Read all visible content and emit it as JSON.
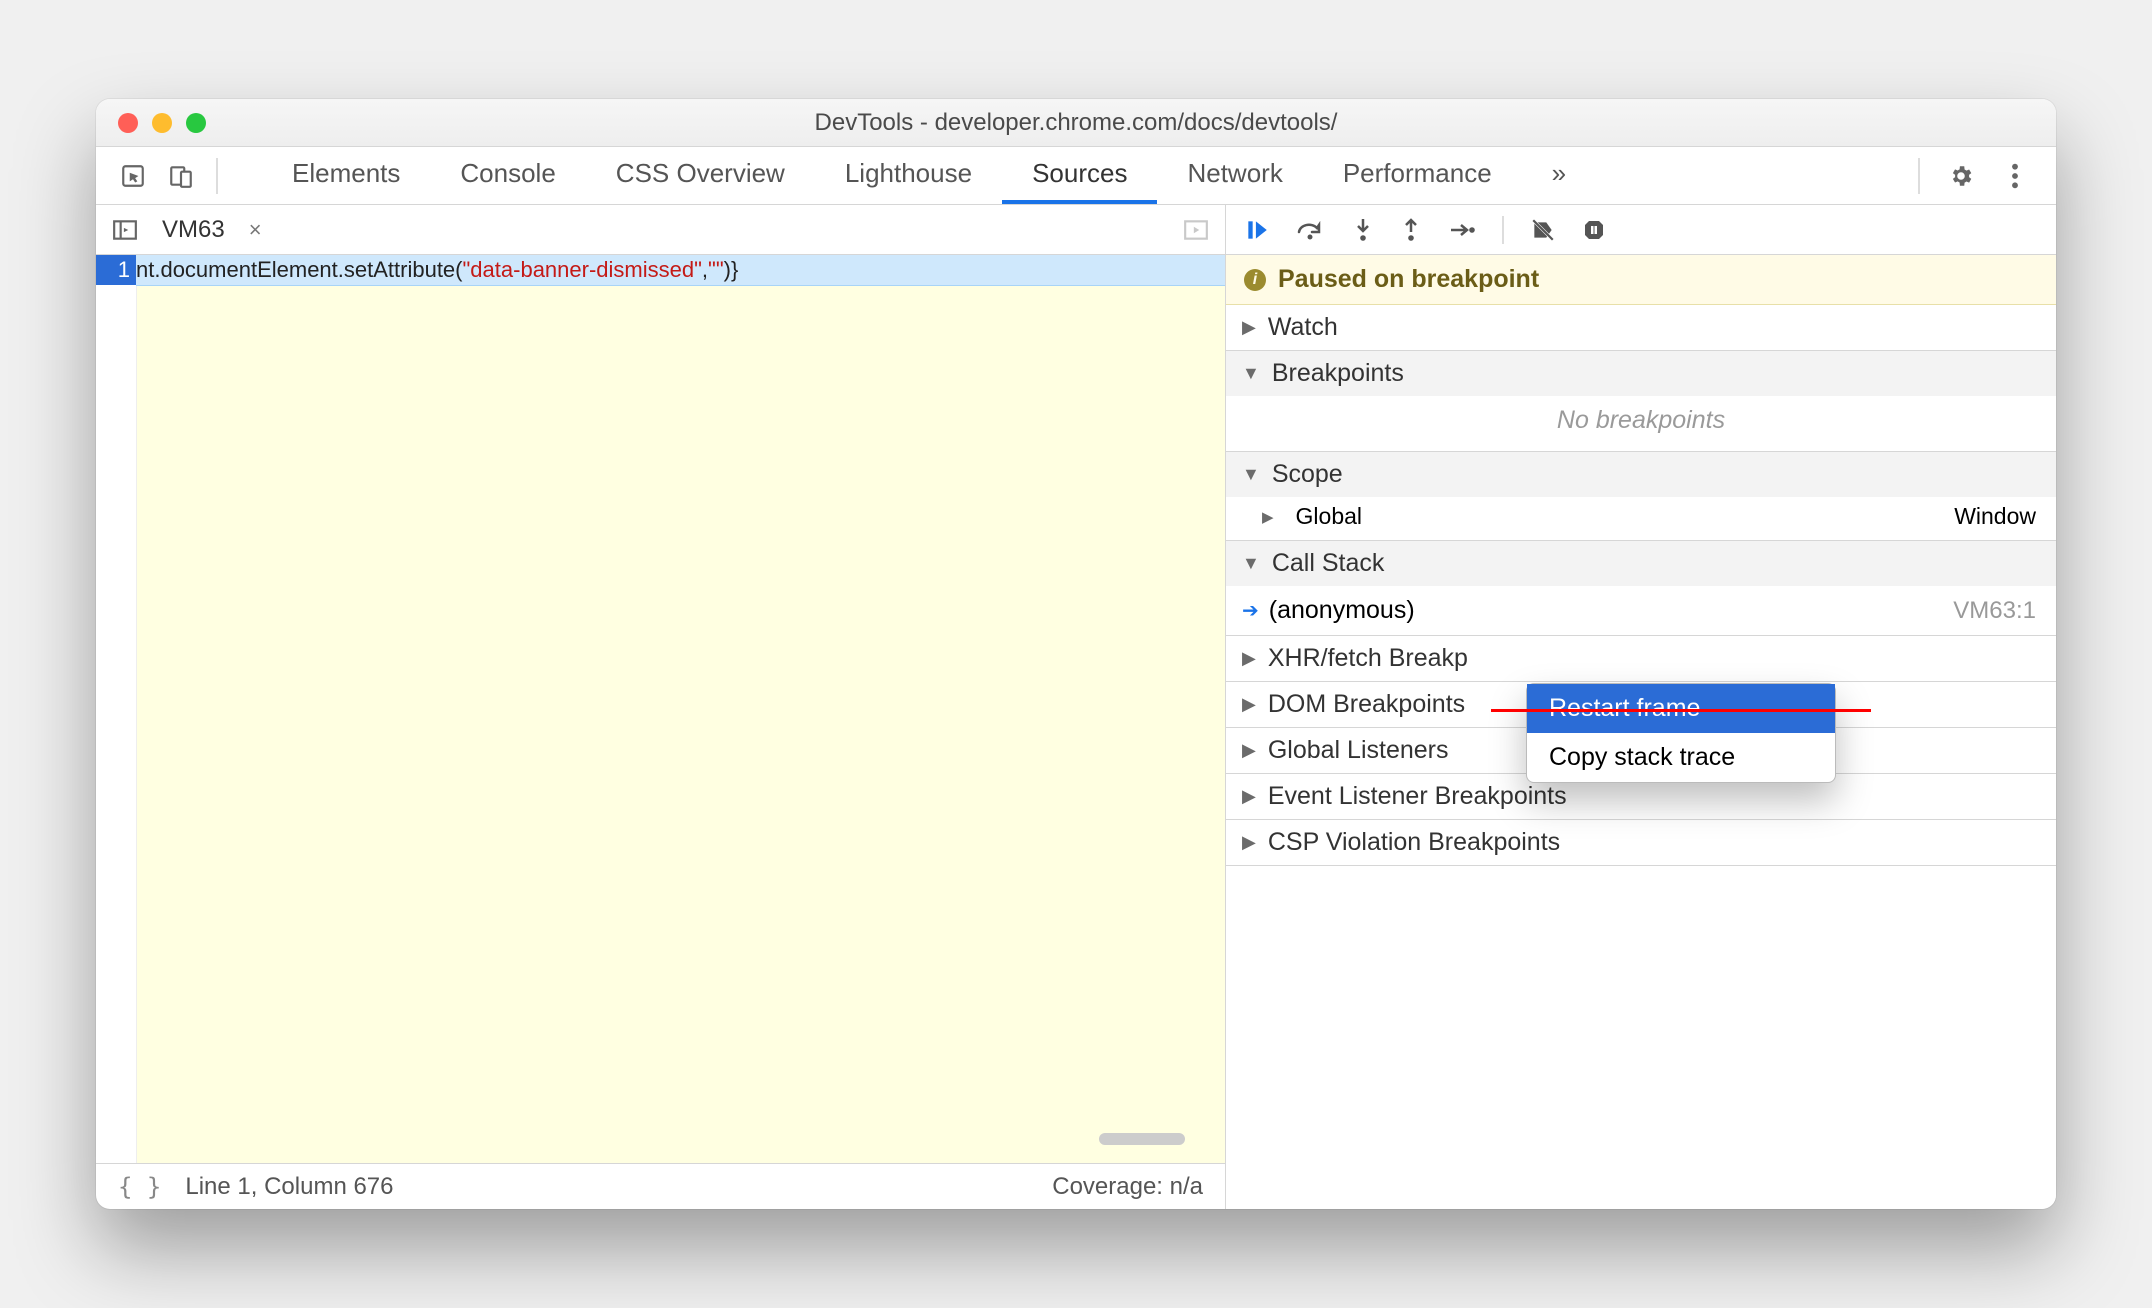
{
  "window": {
    "title": "DevTools - developer.chrome.com/docs/devtools/"
  },
  "mainTabs": {
    "items": [
      "Elements",
      "Console",
      "CSS Overview",
      "Lighthouse",
      "Sources",
      "Network",
      "Performance"
    ],
    "active": "Sources",
    "overflow": "»"
  },
  "sourceTab": {
    "name": "VM63",
    "close": "×"
  },
  "code": {
    "lineNumber": "1",
    "seg1": "nt.documentElement.setAttribute(",
    "seg2": "\"data-banner-dismissed\"",
    "seg3": ",",
    "seg4": "\"\"",
    "seg5": ")}"
  },
  "statusbar": {
    "format": "{ }",
    "pos": "Line 1, Column 676",
    "coverage": "Coverage: n/a"
  },
  "pause": {
    "text": "Paused on breakpoint"
  },
  "sections": {
    "watch": "Watch",
    "breakpoints": "Breakpoints",
    "noBreakpoints": "No breakpoints",
    "scope": "Scope",
    "scopeGlobal": "Global",
    "scopeGlobalVal": "Window",
    "callstack": "Call Stack",
    "stackFrame": "(anonymous)",
    "stackLoc": "VM63:1",
    "xhr": "XHR/fetch Breakp",
    "dom": "DOM Breakpoints",
    "global": "Global Listeners",
    "event": "Event Listener Breakpoints",
    "csp": "CSP Violation Breakpoints"
  },
  "contextMenu": {
    "restart": "Restart frame",
    "copy": "Copy stack trace"
  }
}
